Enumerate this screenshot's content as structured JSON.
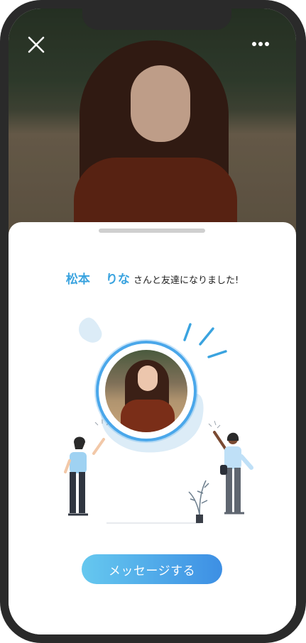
{
  "friend": {
    "name_family": "松本",
    "name_given": "りな",
    "message_suffix": "さんと友達になりました!"
  },
  "actions": {
    "message_button_label": "メッセージする"
  },
  "icons": {
    "close": "close-icon",
    "more": "more-horizontal-icon"
  },
  "colors": {
    "accent": "#3aa3df",
    "button_start": "#66c8ef",
    "button_end": "#3d8fe4",
    "illustration_blob": "#dcecf7"
  }
}
